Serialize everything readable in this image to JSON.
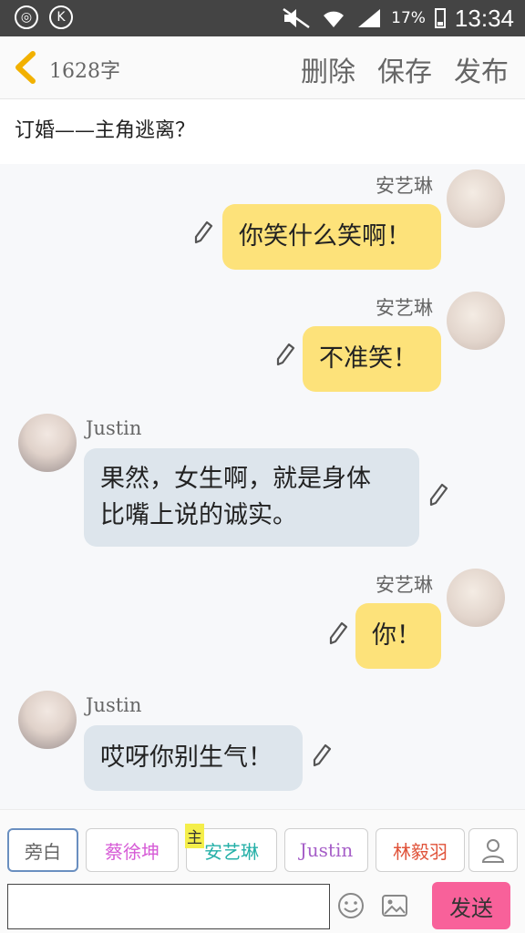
{
  "status_bar": {
    "left_icons": [
      "notification-icon",
      "k-app-icon"
    ],
    "battery": "17%",
    "time": "13:34"
  },
  "toolbar": {
    "word_count": "1628字",
    "delete_label": "删除",
    "save_label": "保存",
    "publish_label": "发布"
  },
  "title": "订婚——主角逃离？",
  "messages": [
    {
      "speaker": "安艺琳",
      "text": "你笑什么笑啊！",
      "side": "right"
    },
    {
      "speaker": "安艺琳",
      "text": "不准笑！",
      "side": "right"
    },
    {
      "speaker": "Justin",
      "line1": "果然，女生啊，就是身体",
      "line2": "比嘴上说的诚实。",
      "side": "left"
    },
    {
      "speaker": "安艺琳",
      "text": "你！",
      "side": "right"
    },
    {
      "speaker": "Justin",
      "text": "哎呀你别生气！",
      "side": "left"
    }
  ],
  "characters": [
    {
      "label": "旁白",
      "color": "#666666"
    },
    {
      "label": "蔡徐坤",
      "color": "#d65bd6"
    },
    {
      "label": "安艺琳",
      "color": "#26b0a8",
      "badge": "主"
    },
    {
      "label": "Justin",
      "color": "#a65fc8"
    },
    {
      "label": "林毅羽",
      "color": "#e0533a"
    }
  ],
  "input": {
    "value": "",
    "send_label": "发送"
  },
  "colors": {
    "own_bubble": "#fde27a",
    "other_bubble": "#dde5ec",
    "send_button": "#f8619a",
    "back_arrow": "#f2b100"
  }
}
